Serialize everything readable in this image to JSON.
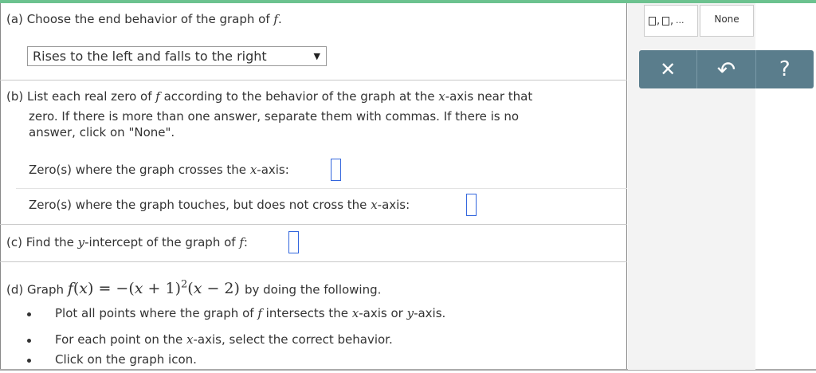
{
  "part_a": {
    "label": "(a)",
    "prompt": "Choose the end behavior of the graph of",
    "func": "f",
    "period": ".",
    "dropdown_value": "Rises to the left and falls to the right"
  },
  "part_b": {
    "label": "(b)",
    "line1_a": "List each real zero of",
    "func": "f",
    "line1_b": "according to the behavior of the graph at the",
    "x": "x",
    "line1_c": "-axis near that",
    "line2": "zero. If there is more than one answer, separate them with commas. If there is no",
    "line3": "answer, click on \"None\".",
    "crosses_label": "Zero(s) where the graph crosses the",
    "crosses_suffix": "-axis:",
    "touches_label": "Zero(s) where the graph touches, but does not cross the",
    "touches_suffix": "-axis:",
    "crosses_value": "",
    "touches_value": ""
  },
  "part_c": {
    "label": "(c)",
    "prompt": "Find the",
    "y": "y",
    "mid": "-intercept of the graph of",
    "func": "f",
    "colon": ":",
    "value": ""
  },
  "part_d": {
    "label": "(d)",
    "prefix": "Graph",
    "func_name": "f",
    "paren_open": "(",
    "var": "x",
    "paren_close": ")",
    "equals": "= −(",
    "x2": "x",
    "plus1": "+ 1)",
    "exp": "2",
    "open2": "(",
    "x3": "x",
    "minus2": "− 2)",
    "suffix": "by doing the following.",
    "bullet1_a": "Plot all points where the graph of",
    "bullet1_func": "f",
    "bullet1_b": "intersects the",
    "bullet1_x": "x",
    "bullet1_c": "-axis or",
    "bullet1_y": "y",
    "bullet1_d": "-axis.",
    "bullet2_a": "For each point on the",
    "bullet2_x": "x",
    "bullet2_b": "-axis, select the correct behavior.",
    "bullet3": "Click on the graph icon."
  },
  "panel": {
    "list_key_comma1": ",",
    "list_key_comma2": ",",
    "list_key_ellipsis": "...",
    "none_label": "None",
    "clear_icon": "✕",
    "undo_icon": "↶",
    "help_icon": "?"
  },
  "colors": {
    "top_bar": "#6cc28f",
    "toolbar": "#5a7d8c",
    "answer_box_border": "#3366dd"
  }
}
